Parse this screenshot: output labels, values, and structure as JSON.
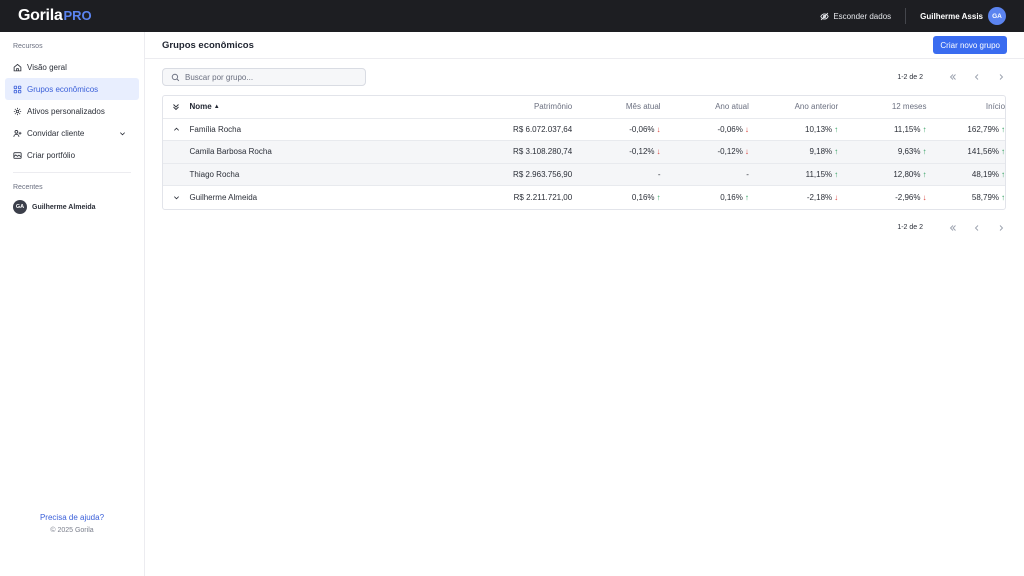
{
  "topbar": {
    "logo_main": "Gorila",
    "logo_pro": "PRO",
    "hide_data_label": "Esconder dados",
    "user_name": "Guilherme Assis",
    "user_initials": "GA"
  },
  "sidebar": {
    "section_resources": "Recursos",
    "items": [
      {
        "label": "Visão geral",
        "icon": "home-icon"
      },
      {
        "label": "Grupos econômicos",
        "icon": "groups-icon"
      },
      {
        "label": "Ativos personalizados",
        "icon": "gear-icon"
      },
      {
        "label": "Convidar cliente",
        "icon": "invite-icon"
      },
      {
        "label": "Criar portfólio",
        "icon": "portfolio-icon"
      }
    ],
    "section_recent": "Recentes",
    "recent": [
      {
        "initials": "GA",
        "name": "Guilherme Almeida"
      }
    ],
    "help_link": "Precisa de ajuda?",
    "copyright": "© 2025 Gorila"
  },
  "main": {
    "title": "Grupos econômicos",
    "create_button": "Criar novo grupo",
    "search_placeholder": "Buscar por grupo...",
    "pager_text": "1-2 de 2"
  },
  "table": {
    "columns": {
      "name": "Nome",
      "patrimonio": "Patrimônio",
      "mes_atual": "Mês atual",
      "ano_atual": "Ano atual",
      "ano_anterior": "Ano anterior",
      "doze_meses": "12 meses",
      "inicio": "Início"
    },
    "rows": [
      {
        "name": "Família Rocha",
        "patrimonio": "R$ 6.072.037,64",
        "mes": "-0,06%",
        "ano": "-0,06%",
        "ant": "10,13%",
        "m12": "11,15%",
        "ini": "162,79%"
      },
      {
        "name": "Camila Barbosa Rocha",
        "patrimonio": "R$ 3.108.280,74",
        "mes": "-0,12%",
        "ano": "-0,12%",
        "ant": "9,18%",
        "m12": "9,63%",
        "ini": "141,56%"
      },
      {
        "name": "Thiago Rocha",
        "patrimonio": "R$ 2.963.756,90",
        "mes": "-",
        "ano": "-",
        "ant": "11,15%",
        "m12": "12,80%",
        "ini": "48,19%"
      },
      {
        "name": "Guilherme Almeida",
        "patrimonio": "R$ 2.211.721,00",
        "mes": "0,16%",
        "ano": "0,16%",
        "ant": "-2,18%",
        "m12": "-2,96%",
        "ini": "58,79%"
      }
    ]
  },
  "colors": {
    "accent": "#3a6cf0",
    "up": "#2c9c5c",
    "down": "#d9433c"
  }
}
